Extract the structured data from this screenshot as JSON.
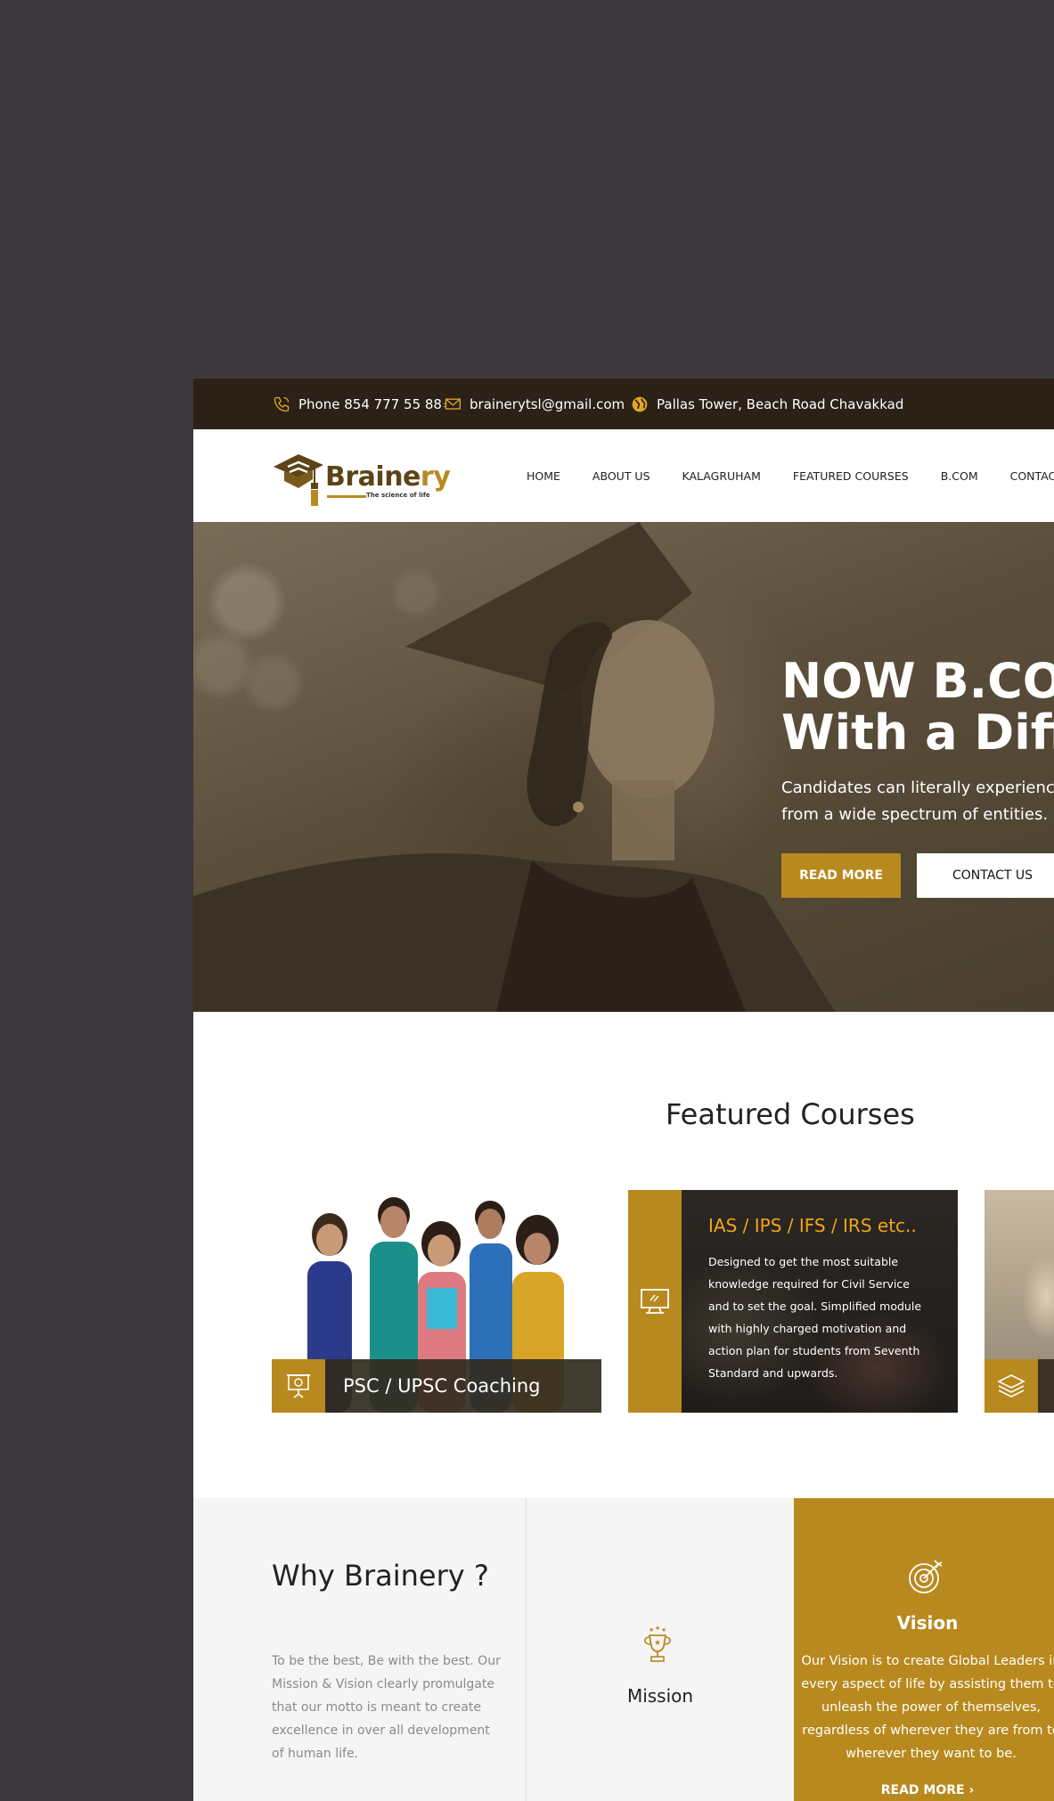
{
  "topbar": {
    "phone": "Phone 854 777 55 88",
    "email": "brainerytsl@gmail.com",
    "address": "Pallas Tower, Beach Road Chavakkad"
  },
  "brand": {
    "name_main": "Braine",
    "name_accent": "ry",
    "tagline": "The science of life"
  },
  "nav": {
    "items": [
      "HOME",
      "ABOUT US",
      "KALAGRUHAM",
      "FEATURED COURSES",
      "B.COM",
      "CONTACT"
    ]
  },
  "hero": {
    "title_line1": "NOW B.COM",
    "title_line2": "With a Difference",
    "subtitle_line1": "Candidates can literally experience",
    "subtitle_line2": "from a wide spectrum of entities.",
    "read_more": "READ MORE",
    "contact_us": "CONTACT US"
  },
  "featured": {
    "heading": "Featured Courses",
    "card1_label": "PSC / UPSC Coaching",
    "card2_title": "IAS / IPS / IFS / IRS etc..",
    "card2_text": "Designed to get the most suitable knowledge required for Civil Service and to set the goal. Simplified module with highly charged motivation and action plan for students from Seventh Standard and upwards."
  },
  "why": {
    "heading": "Why Brainery ?",
    "text": "To be the best, Be with the best. Our Mission & Vision clearly promulgate that our motto is meant to create excellence in over all development of human life.",
    "mission_label": "Mission",
    "vision_label": "Vision",
    "vision_text": "Our Vision is to create Global Leaders in every aspect of life by assisting them to unleash the power of themselves, regardless of wherever they are from to wherever they want to be.",
    "vision_more": "READ MORE"
  },
  "colors": {
    "accent": "#b8891f",
    "topbar_bg": "#2b2116",
    "outer_bg": "#3a383a"
  }
}
